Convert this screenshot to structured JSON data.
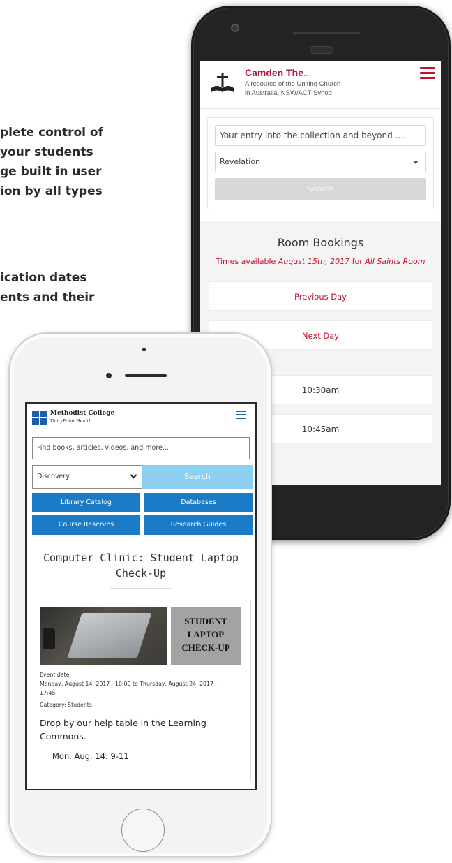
{
  "background_text": {
    "line1": "plete control of",
    "line2": "your students",
    "line3": "ge built in user",
    "line4": "ion by all types",
    "line5": "ication dates",
    "line6": "ents and their"
  },
  "phone1": {
    "site_title": "Camden The",
    "site_title_ellipsis": "...",
    "subtitle_line1": "A resource of the Uniting Church",
    "subtitle_line2": "in Australia, NSW/ACT Synod",
    "logo_icon": "bible-cross-icon",
    "menu_icon": "hamburger-menu-icon",
    "search": {
      "placeholder": "Your entry into the collection and beyond ....",
      "select_value": "Revelation",
      "button_label": "Search"
    },
    "bookings": {
      "title": "Room Bookings",
      "avail_prefix": "Times available ",
      "avail_date": "August 15th, 2017",
      "avail_for": " for ",
      "avail_room": "All Saints Room",
      "prev_label": "Previous Day",
      "next_label": "Next Day",
      "slots": [
        "10:30am",
        "10:45am"
      ]
    },
    "colors": {
      "accent": "#c0112d",
      "button_disabled": "#d8d8d8"
    }
  },
  "phone2": {
    "brand_line1": "Methodist College",
    "brand_line2": "UnityPoint Health",
    "logo_icon": "methodist-college-logo-icon",
    "menu_icon": "hamburger-menu-icon",
    "search": {
      "placeholder": "Find books, articles, videos, and more...",
      "select_value": "Discovery",
      "button_label": "Search"
    },
    "quick_links": [
      "Library Catalog",
      "Databases",
      "Course Reserves",
      "Research Guides"
    ],
    "event": {
      "title_line1": "Computer Clinic: Student Laptop",
      "title_line2": "Check-Up",
      "image_sign_line1": "STUDENT",
      "image_sign_line2": "LAPTOP",
      "image_sign_line3": "CHECK-UP",
      "date_label": "Event date:",
      "date_line1": "Monday, August 14, 2017 - 10:00 to Thursday, August 24, 2017 -",
      "date_line2": "17:45",
      "category": "Category: Students",
      "description_line1": "Drop by our help table in the Learning",
      "description_line2": "Commons.",
      "schedule_line": "Mon. Aug. 14:  9-11"
    },
    "colors": {
      "brand_blue": "#1b7bc7",
      "search_button": "#8ccff0"
    }
  }
}
